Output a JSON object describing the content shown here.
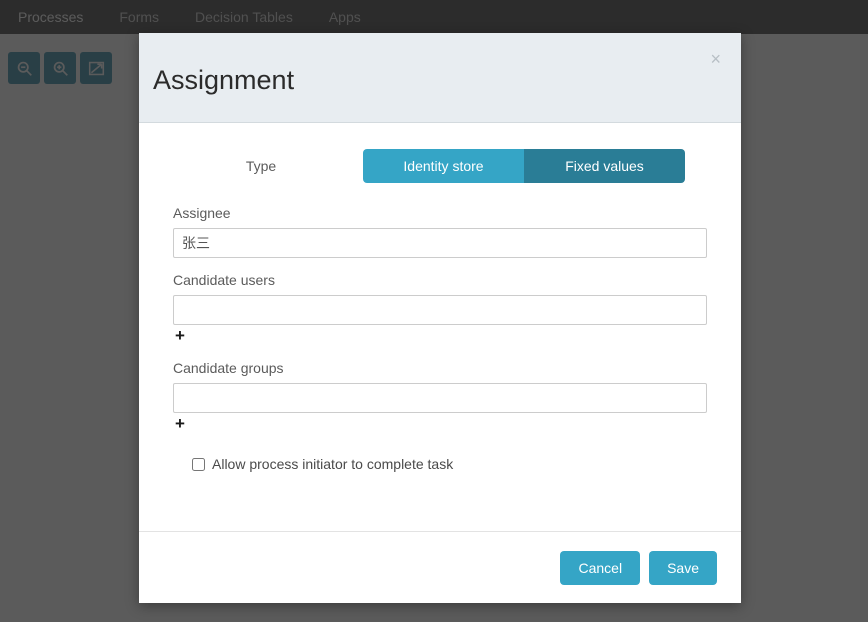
{
  "background": {
    "nav_tabs": [
      {
        "label": "Processes",
        "active": true
      },
      {
        "label": "Forms",
        "active": false
      },
      {
        "label": "Decision Tables",
        "active": false
      },
      {
        "label": "Apps",
        "active": false
      }
    ],
    "toolbar": [
      {
        "name": "zoom-out-icon",
        "title": "Zoom out"
      },
      {
        "name": "zoom-in-icon",
        "title": "Zoom in"
      },
      {
        "name": "fit-to-screen-icon",
        "title": "Fit to screen"
      }
    ]
  },
  "modal": {
    "title": "Assignment",
    "close_label": "×",
    "type": {
      "label": "Type",
      "options": [
        {
          "label": "Identity store",
          "active": false
        },
        {
          "label": "Fixed values",
          "active": true
        }
      ]
    },
    "fields": [
      {
        "label": "Assignee",
        "value": "张三",
        "placeholder": "",
        "has_add_button": false
      },
      {
        "label": "Candidate users",
        "value": "",
        "placeholder": "",
        "has_add_button": true,
        "add_label": "+"
      },
      {
        "label": "Candidate groups",
        "value": "",
        "placeholder": "",
        "has_add_button": true,
        "add_label": "+"
      }
    ],
    "checkbox": {
      "label": "Allow process initiator to complete task",
      "checked": false
    },
    "footer": {
      "cancel_label": "Cancel",
      "save_label": "Save"
    }
  },
  "colors": {
    "accent": "#35a5c6",
    "accent_active": "#2a7d96",
    "header_bg": "#e8edf1",
    "navbar_bg": "#3b3b3b"
  }
}
